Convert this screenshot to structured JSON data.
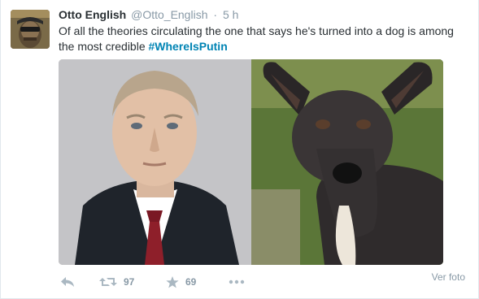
{
  "author": {
    "fullname": "Otto English",
    "username": "@Otto_English",
    "separator": "·",
    "timestamp": "5 h"
  },
  "tweet": {
    "text_part1": "Of all the theories circulating the one that says he's turned into a dog is among the most credible ",
    "hashtag": "#WhereIsPutin"
  },
  "actions": {
    "retweet_count": "97",
    "favorite_count": "69",
    "view_photo_label": "Ver foto"
  },
  "icons": {
    "reply": "reply-icon",
    "retweet": "retweet-icon",
    "favorite": "star-icon",
    "more": "more-icon"
  },
  "colors": {
    "link": "#0084b4",
    "muted": "#8899a6",
    "text": "#292f33"
  }
}
